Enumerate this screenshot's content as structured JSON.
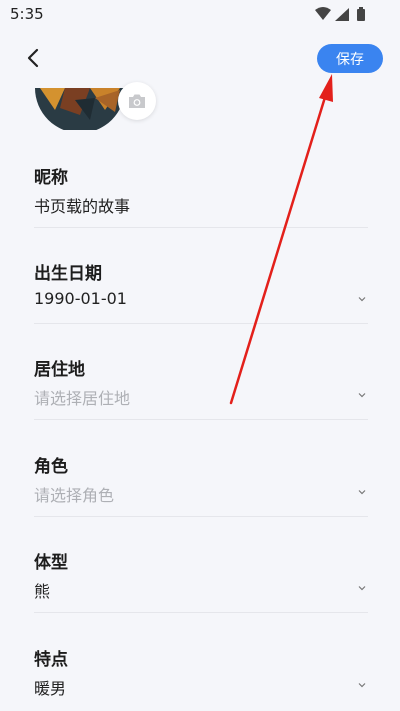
{
  "status_bar": {
    "time": "5:35",
    "icons": [
      "wifi-icon",
      "cellular-icon",
      "battery-icon"
    ]
  },
  "header": {
    "back_icon": "chevron-left-icon",
    "save_label": "保存"
  },
  "avatar": {
    "camera_icon": "camera-icon"
  },
  "fields": [
    {
      "label": "昵称",
      "value": "书页载的故事",
      "placeholder": false,
      "has_chevron": false
    },
    {
      "label": "出生日期",
      "value": "1990-01-01",
      "placeholder": false,
      "has_chevron": true
    },
    {
      "label": "居住地",
      "value": "请选择居住地",
      "placeholder": true,
      "has_chevron": true
    },
    {
      "label": "角色",
      "value": "请选择角色",
      "placeholder": true,
      "has_chevron": true
    },
    {
      "label": "体型",
      "value": "熊",
      "placeholder": false,
      "has_chevron": true
    },
    {
      "label": "特点",
      "value": "暖男",
      "placeholder": false,
      "has_chevron": true
    }
  ],
  "colors": {
    "accent": "#3a84f0",
    "background": "#f5f6fa",
    "annotation_arrow": "#e3201b"
  }
}
